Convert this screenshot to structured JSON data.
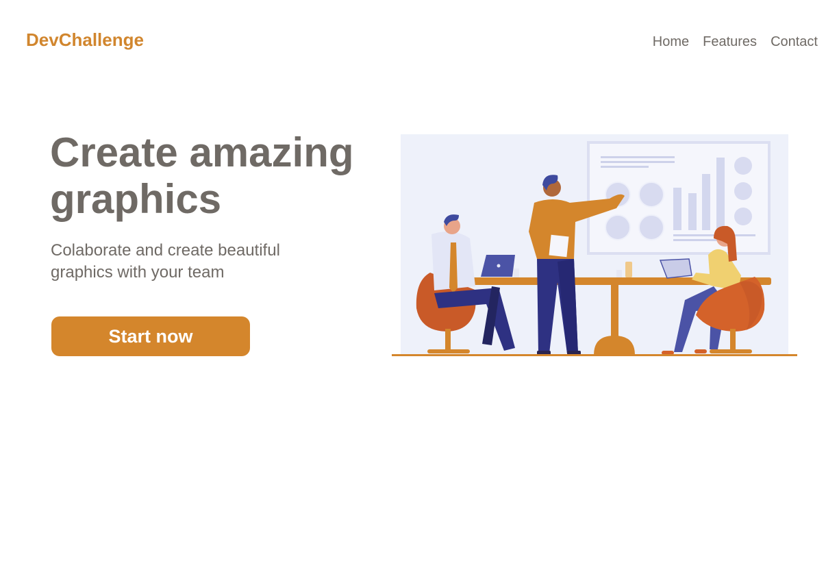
{
  "header": {
    "logo": "DevChallenge",
    "nav": [
      {
        "label": "Home"
      },
      {
        "label": "Features"
      },
      {
        "label": "Contact"
      }
    ]
  },
  "hero": {
    "title": "Create amazing graphics",
    "subtitle": "Colaborate and create beautiful graphics with your team",
    "cta_label": "Start now",
    "illustration": "team-meeting-presentation-illustration"
  },
  "colors": {
    "accent": "#d4862c",
    "text": "#6f6a65",
    "background": "#ffffff",
    "illustration_bg": "#eef1fa",
    "navy": "#2e3182"
  }
}
